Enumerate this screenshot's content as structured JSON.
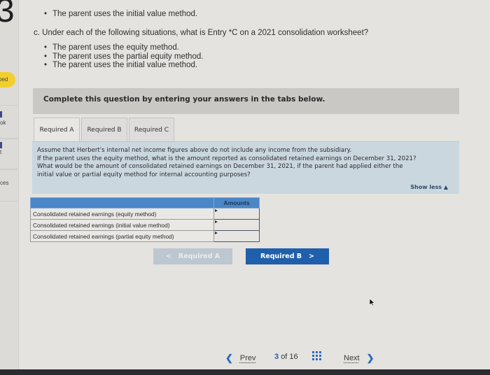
{
  "sidebar": {
    "question_number": "3",
    "status_badge": "bed",
    "items": [
      {
        "label": "ok"
      },
      {
        "label": "t"
      },
      {
        "label": "ces"
      }
    ]
  },
  "question": {
    "prev_bullet": "The parent uses the initial value method.",
    "part_c": "c. Under each of the following situations, what is Entry *C on a 2021 consolidation worksheet?",
    "part_c_bullets": [
      "The parent uses the equity method.",
      "The parent uses the partial equity method.",
      "The parent uses the initial value method."
    ]
  },
  "instruction": "Complete this question by entering your answers in the tabs below.",
  "tabs": [
    {
      "label": "Required A",
      "active": true
    },
    {
      "label": "Required B",
      "active": false
    },
    {
      "label": "Required C",
      "active": false
    }
  ],
  "prompt": {
    "lines": [
      "Assume that Herbert's internal net income figures above do not include any income from the subsidiary.",
      "If the parent uses the equity method, what is the amount reported as consolidated retained earnings on December 31, 2021?",
      "What would be the amount of consolidated retained earnings on December 31, 2021, if the parent had applied either the",
      "initial value or partial equity method for internal accounting purposes?"
    ],
    "show_less": "Show less ▲"
  },
  "answer_table": {
    "header": "Amounts",
    "rows": [
      {
        "label": "Consolidated retained earnings (equity method)",
        "value": ""
      },
      {
        "label": "Consolidated retained earnings (initial value method)",
        "value": ""
      },
      {
        "label": "Consolidated retained earnings (partial equity method)",
        "value": ""
      }
    ]
  },
  "nav_buttons": {
    "prev_tab": "Required A",
    "next_tab": "Required B",
    "prev_chevron": "<",
    "next_chevron": ">"
  },
  "pager": {
    "prev": "Prev",
    "current": "3",
    "of": "of 16",
    "next": "Next",
    "prev_chevron": "❮",
    "next_chevron": "❯"
  },
  "colors": {
    "primary_button": "#1f5fab",
    "disabled_button": "#bcc7d0",
    "table_header": "#4b86c6",
    "prompt_bg": "#cbd7df",
    "badge": "#f1cf2e"
  }
}
